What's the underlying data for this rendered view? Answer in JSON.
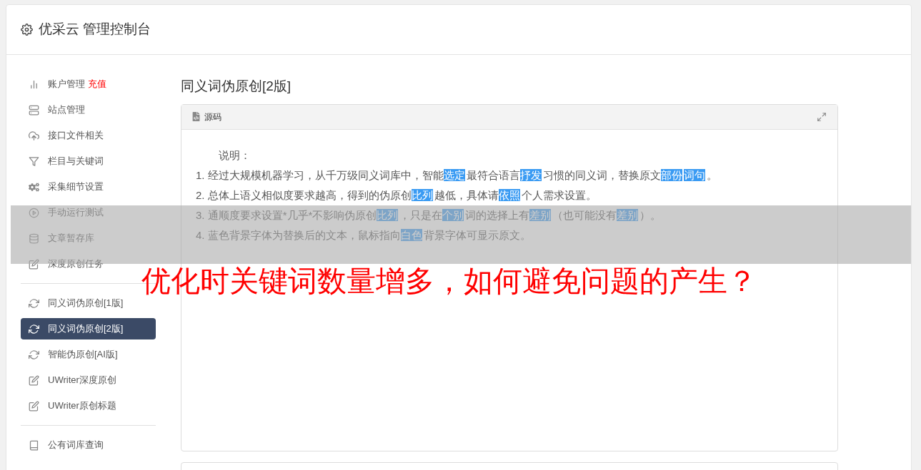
{
  "header": {
    "title": "优采云 管理控制台"
  },
  "sidebar": {
    "groups": [
      {
        "items": [
          {
            "label": "账户管理",
            "badge": "充值",
            "selected": false
          },
          {
            "label": "站点管理",
            "selected": false
          },
          {
            "label": "接口文件相关",
            "selected": false
          },
          {
            "label": "栏目与关键词",
            "selected": false
          },
          {
            "label": "采集细节设置",
            "selected": false
          },
          {
            "label": "手动运行测试",
            "selected": false
          },
          {
            "label": "文章暂存库",
            "selected": false
          },
          {
            "label": "深度原创任务",
            "selected": false
          }
        ]
      },
      {
        "items": [
          {
            "label": "同义词伪原创[1版]",
            "selected": false
          },
          {
            "label": "同义词伪原创[2版]",
            "selected": true
          },
          {
            "label": "智能伪原创[AI版]",
            "selected": false
          },
          {
            "label": "UWriter深度原创",
            "selected": false
          },
          {
            "label": "UWriter原创标题",
            "selected": false
          }
        ]
      },
      {
        "items": [
          {
            "label": "公有词库查询",
            "selected": false
          }
        ]
      }
    ]
  },
  "page_title": "同义词伪原创[2版]",
  "editor": {
    "toolbar_label": "源码",
    "intro": "说明：",
    "lines": [
      [
        {
          "text": "1. 经过大规模机器学习，从千万级同义词库中，智能",
          "replaced": false
        },
        {
          "text": "选定",
          "replaced": true
        },
        {
          "text": "最符合语言",
          "replaced": false
        },
        {
          "text": "抒发",
          "replaced": true
        },
        {
          "text": "习惯的同义词，替换原文",
          "replaced": false
        },
        {
          "text": "部份",
          "replaced": true
        },
        {
          "text": "词句",
          "replaced": true
        },
        {
          "text": "。",
          "replaced": false
        }
      ],
      [
        {
          "text": "2. 总体上语义相似度要求越高，得到的伪原创",
          "replaced": false
        },
        {
          "text": "比列",
          "replaced": true
        },
        {
          "text": "越低，具体请",
          "replaced": false
        },
        {
          "text": "依照",
          "replaced": true
        },
        {
          "text": "个人需求设置。",
          "replaced": false
        }
      ],
      [
        {
          "text": "3. 通顺度要求设置*几乎*不影响伪原创",
          "replaced": false
        },
        {
          "text": "比列",
          "replaced": true
        },
        {
          "text": "，只是在",
          "replaced": false
        },
        {
          "text": "个别",
          "replaced": true
        },
        {
          "text": "词的选择上有",
          "replaced": false
        },
        {
          "text": "差别",
          "replaced": true
        },
        {
          "text": "（也可能没有",
          "replaced": false
        },
        {
          "text": "差别",
          "replaced": true
        },
        {
          "text": "）。",
          "replaced": false
        }
      ],
      [
        {
          "text": "4. 蓝色背景字体为替换后的文本，鼠标指向",
          "replaced": false
        },
        {
          "text": "白色",
          "replaced": true
        },
        {
          "text": "背景字体可显示原文。",
          "replaced": false
        }
      ]
    ]
  },
  "overlay_banner": {
    "headline": "优化时关键词数量增多，如何避免问题的产生？"
  }
}
